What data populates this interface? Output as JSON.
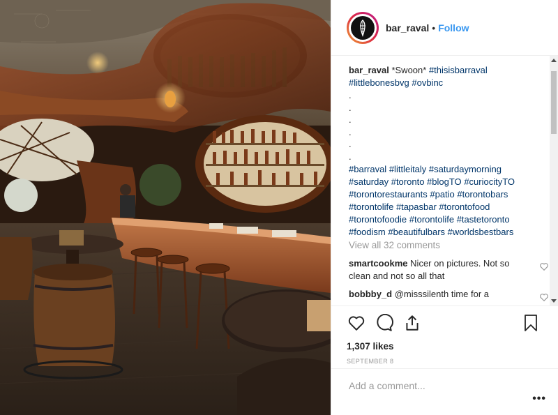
{
  "post": {
    "username": "bar_raval",
    "follow_label": "Follow",
    "separator": "•",
    "photo_icon": "bar-interior-photo"
  },
  "caption": {
    "username": "bar_raval",
    "text_intro": "*Swoon*",
    "tags_line1": [
      "#thisisbarraval"
    ],
    "tags_line2": [
      "#littlebonesbvg",
      "#ovbinc"
    ],
    "dots": [
      ".",
      ".",
      ".",
      ".",
      ".",
      "."
    ],
    "hashtags": [
      "#barraval",
      "#littleitaly",
      "#saturdaymorning",
      "#saturday",
      "#toronto",
      "#blogTO",
      "#curiocityTO",
      "#torontorestaurants",
      "#patio",
      "#torontobars",
      "#torontolife",
      "#tapasbar",
      "#torontofood",
      "#torontofoodie",
      "#torontolife",
      "#tastetoronto",
      "#foodism",
      "#beautifulbars",
      "#worldsbestbars"
    ]
  },
  "view_all_label": "View all 32 comments",
  "comments": [
    {
      "user": "smartcookme",
      "text": "Nicer on pictures. Not so clean and not so all that"
    },
    {
      "user": "bobbby_d",
      "text": "@misssilenth time for a"
    }
  ],
  "actions": {
    "like_icon": "heart-icon",
    "comment_icon": "comment-icon",
    "share_icon": "share-icon",
    "save_icon": "bookmark-icon"
  },
  "likes_label": "1,307 likes",
  "date_label": "SEPTEMBER 8",
  "add_comment_placeholder": "Add a comment...",
  "more_label": "•••",
  "colors": {
    "link": "#3897f0",
    "hashtag": "#003569",
    "muted": "#999999",
    "text": "#262626"
  }
}
